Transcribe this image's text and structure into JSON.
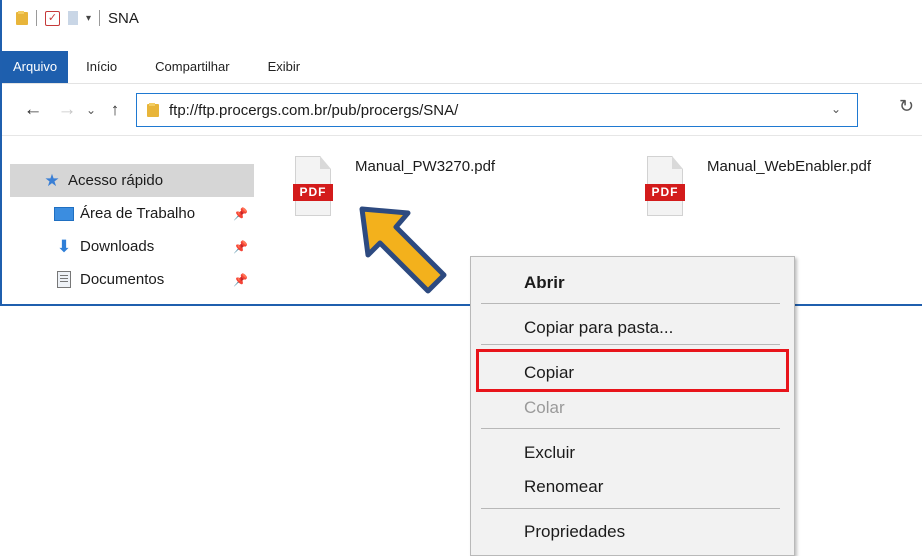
{
  "title_bar": {
    "title": "SNA",
    "quick_access_dropdown": "▾"
  },
  "ribbon": {
    "tabs": [
      "Arquivo",
      "Início",
      "Compartilhar",
      "Exibir"
    ]
  },
  "address_bar": {
    "path": "ftp://ftp.procergs.com.br/pub/procergs/SNA/"
  },
  "sidebar": {
    "items": [
      {
        "label": "Acesso rápido",
        "icon": "star-icon"
      },
      {
        "label": "Área de Trabalho",
        "icon": "desktop-icon",
        "pin": "📌"
      },
      {
        "label": "Downloads",
        "icon": "download-arrow-icon",
        "pin": "📌"
      },
      {
        "label": "Documentos",
        "icon": "documents-icon",
        "pin": "📌"
      }
    ]
  },
  "files": [
    {
      "name": "Manual_PW3270.pdf",
      "badge": "PDF"
    },
    {
      "name": "Manual_WebEnabler.pdf",
      "badge": "PDF"
    }
  ],
  "context_menu": {
    "items": [
      {
        "label": "Abrir"
      },
      {
        "label": "Copiar para pasta..."
      },
      {
        "label": "Copiar"
      },
      {
        "label": "Colar"
      },
      {
        "label": "Excluir"
      },
      {
        "label": "Renomear"
      },
      {
        "label": "Propriedades"
      }
    ],
    "highlighted": "Copiar"
  },
  "colors": {
    "accent": "#1e5fae",
    "highlight_border": "#e8141b",
    "arrow_fill": "#f3b11c",
    "arrow_stroke": "#2d4a80",
    "pdf_red": "#d31b1b"
  }
}
